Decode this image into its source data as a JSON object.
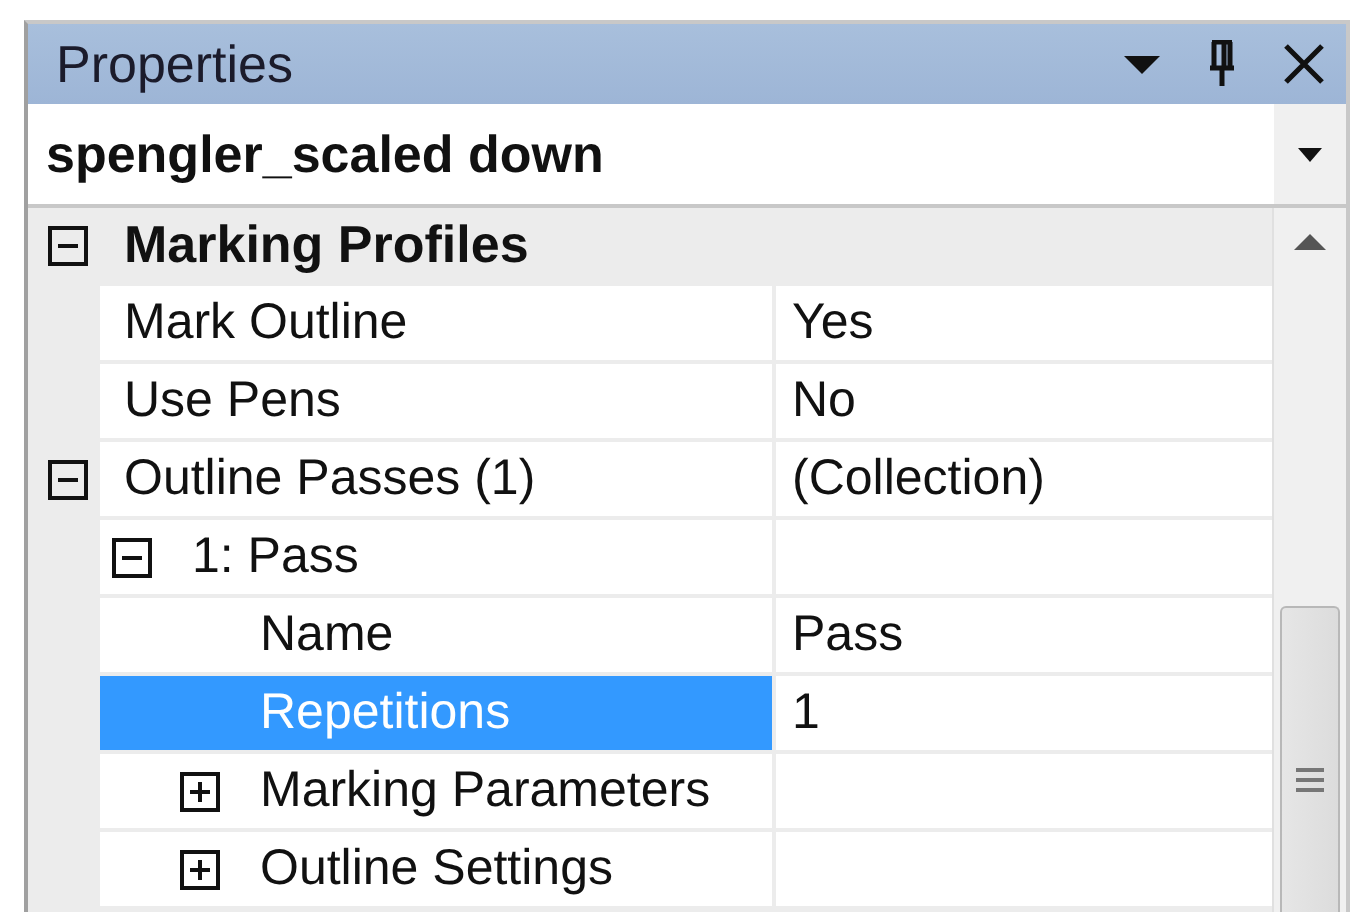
{
  "panel": {
    "title": "Properties"
  },
  "object_selector": {
    "value": "spengler_scaled down"
  },
  "grid": {
    "categories": [
      {
        "label": "Marking Profiles",
        "expanded": true,
        "properties": [
          {
            "name": "Mark Outline",
            "value": "Yes",
            "selected": false
          },
          {
            "name": "Use Pens",
            "value": "No",
            "selected": false
          },
          {
            "name": "Outline Passes  (1)",
            "value": "(Collection)",
            "selected": false,
            "expanded": true,
            "children": [
              {
                "name": "1: Pass",
                "selected": false,
                "expanded": true,
                "children": [
                  {
                    "name": "Name",
                    "value": "Pass",
                    "selected": false
                  },
                  {
                    "name": "Repetitions",
                    "value": "1",
                    "selected": true
                  },
                  {
                    "name": "Marking Parameters",
                    "selected": false,
                    "expanded": false
                  },
                  {
                    "name": "Outline Settings",
                    "selected": false,
                    "expanded": false
                  }
                ]
              }
            ]
          }
        ]
      }
    ]
  }
}
